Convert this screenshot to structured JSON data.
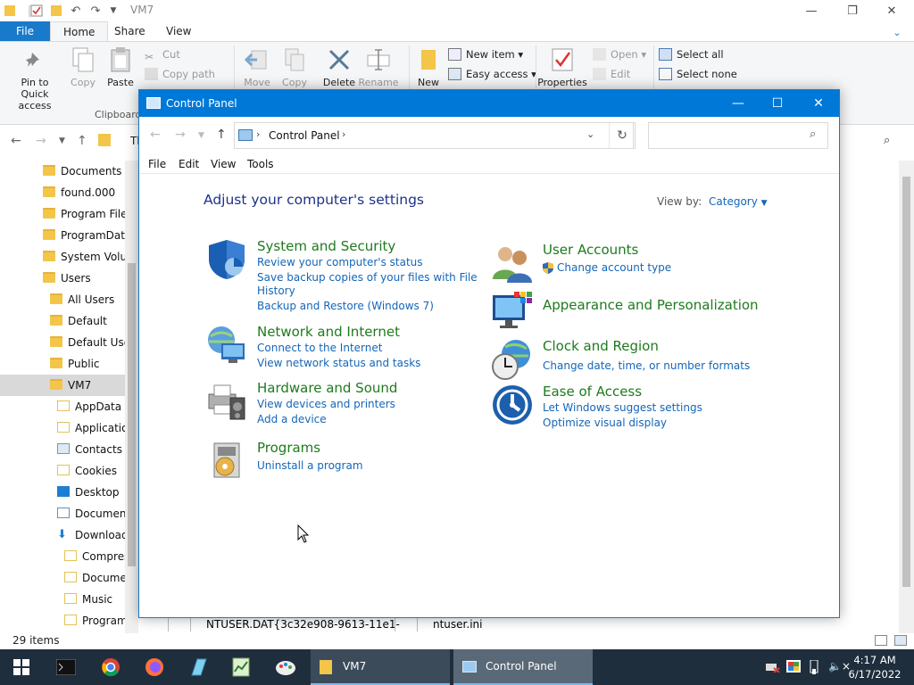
{
  "explorer": {
    "title": "VM7",
    "tabs": {
      "file": "File",
      "home": "Home",
      "share": "Share",
      "view": "View"
    },
    "ribbon": {
      "pin_label_1": "Pin to Quick",
      "pin_label_2": "access",
      "copy": "Copy",
      "paste": "Paste",
      "cut": "Cut",
      "copy_path": "Copy path",
      "clipboard_group": "Clipboard",
      "move": "Move",
      "copy_to": "Copy",
      "delete": "Delete",
      "rename": "Rename",
      "new": "New",
      "new_item": "New item",
      "easy_access": "Easy access",
      "properties": "Properties",
      "open": "Open",
      "edit": "Edit",
      "select_all": "Select all",
      "select_none": "Select none"
    },
    "address_partial": "Th",
    "tree": [
      {
        "label": "Documents a",
        "indent": 1
      },
      {
        "label": "found.000",
        "indent": 1
      },
      {
        "label": "Program Files",
        "indent": 1
      },
      {
        "label": "ProgramData",
        "indent": 1
      },
      {
        "label": "System Volun",
        "indent": 1
      },
      {
        "label": "Users",
        "indent": 1
      },
      {
        "label": "All Users",
        "indent": 2
      },
      {
        "label": "Default",
        "indent": 2
      },
      {
        "label": "Default User",
        "indent": 2
      },
      {
        "label": "Public",
        "indent": 2
      },
      {
        "label": "VM7",
        "indent": 2
      },
      {
        "label": "AppData",
        "indent": 3
      },
      {
        "label": "Applicatio",
        "indent": 3
      },
      {
        "label": "Contacts",
        "indent": 3
      },
      {
        "label": "Cookies",
        "indent": 3
      },
      {
        "label": "Desktop",
        "indent": 3
      },
      {
        "label": "Document",
        "indent": 3
      },
      {
        "label": "Download",
        "indent": 3
      },
      {
        "label": "Compres",
        "indent": 4
      },
      {
        "label": "Docume",
        "indent": 4
      },
      {
        "label": "Music",
        "indent": 4
      },
      {
        "label": "Program",
        "indent": 4
      }
    ],
    "files_row": {
      "file1": "NTUSER.DAT{3c32e908-9613-11e1-",
      "file2": "ntuser.ini"
    },
    "status": "29 items"
  },
  "control_panel": {
    "title": "Control Panel",
    "address": "Control Panel",
    "menu": {
      "file": "File",
      "edit": "Edit",
      "view": "View",
      "tools": "Tools"
    },
    "heading": "Adjust your computer's settings",
    "view_by_label": "View by:",
    "view_by_value": "Category",
    "categories": {
      "system": {
        "title": "System and Security",
        "links": [
          "Review your computer's status",
          "Save backup copies of your files with File",
          "History",
          "Backup and Restore (Windows 7)"
        ]
      },
      "network": {
        "title": "Network and Internet",
        "links": [
          "Connect to the Internet",
          "View network status and tasks"
        ]
      },
      "hardware": {
        "title": "Hardware and Sound",
        "links": [
          "View devices and printers",
          "Add a device"
        ]
      },
      "programs": {
        "title": "Programs",
        "links": [
          "Uninstall a program"
        ]
      },
      "users": {
        "title": "User Accounts",
        "links": [
          "Change account type"
        ]
      },
      "appearance": {
        "title": "Appearance and Personalization",
        "links": []
      },
      "clock": {
        "title": "Clock and Region",
        "links": [
          "Change date, time, or number formats"
        ]
      },
      "ease": {
        "title": "Ease of Access",
        "links": [
          "Let Windows suggest settings",
          "Optimize visual display"
        ]
      }
    }
  },
  "taskbar": {
    "tasks": {
      "vm7": "VM7",
      "control_panel": "Control Panel"
    },
    "clock_time": "4:17 AM",
    "clock_date": "6/17/2022"
  },
  "colors": {
    "accent": "#0078d7",
    "category_title": "#1e7a1e",
    "link": "#1466b8",
    "heading": "#1e3287",
    "taskbar": "#1f2e3d"
  }
}
